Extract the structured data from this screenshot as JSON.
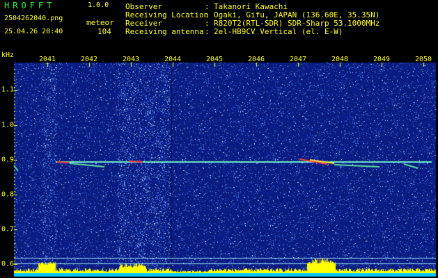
{
  "header": {
    "app_name": "HROFFT",
    "version": "1.0.0",
    "filename": "2504262040.png",
    "datetime": "25.04.26 20:40",
    "event_label": "meteor",
    "event_count": "104",
    "fields": [
      {
        "label": "Observer",
        "value": "Takanori Kawachi"
      },
      {
        "label": "Receiving Location",
        "value": "Ogaki, Gifu, JAPAN (136.60E, 35.35N)"
      },
      {
        "label": "Receiver",
        "value": "R820T2(RTL-SDR) SDR-Sharp 53.1000MHz"
      },
      {
        "label": "Receiving antenna",
        "value": "2el-HB9CV Vertical (el. E-W)"
      }
    ],
    "separator": ":"
  },
  "axes": {
    "y_unit": "kHz",
    "x_ticks": [
      "2041",
      "2042",
      "2043",
      "2044",
      "2045",
      "2046",
      "2047",
      "2048",
      "2049",
      "2050"
    ],
    "y_ticks": [
      "1.1",
      "1.0",
      "0.9",
      "0.8",
      "0.7",
      "0.6"
    ]
  },
  "colors": {
    "text": "#ffff33",
    "title": "#39f84f",
    "background": "#000000",
    "noise_base": "#0a1f7a",
    "carrier": "#7fffff",
    "histogram": "#ffff00",
    "histogram_base": "#00c8ff"
  }
}
